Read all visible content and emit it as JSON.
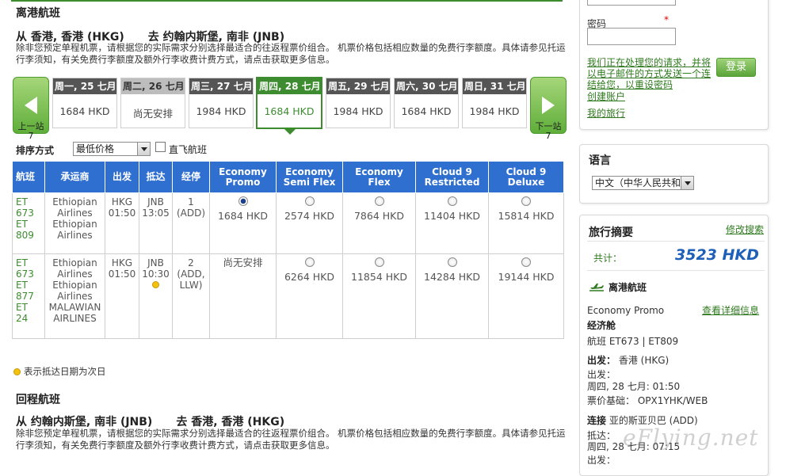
{
  "outbound": {
    "heading": "离港航班",
    "route_from": "从 香港, 香港 (HKG)",
    "route_to": "去 约翰内斯堡, 南非 (JNB)",
    "note": "除非您预定单程机票，请根据您的实际需求分别选择最适合的往返程票价组合。 机票价格包括相应数量的免费行李额度。具体请参见托运行李须知，有关免费行李额度及额外行李收费计费方式，请点击获取更多信息。"
  },
  "carousel": {
    "prev_label": "上一站 7",
    "next_label": "下一站 7",
    "days": [
      {
        "label": "周一, 25 七月",
        "price": "1684 HKD",
        "state": "normal"
      },
      {
        "label": "周二, 26 七月",
        "price": "尚无安排",
        "state": "na"
      },
      {
        "label": "周三, 27 七月",
        "price": "1984 HKD",
        "state": "normal"
      },
      {
        "label": "周四, 28 七月",
        "price": "1684 HKD",
        "state": "selected"
      },
      {
        "label": "周五, 29 七月",
        "price": "1984 HKD",
        "state": "normal"
      },
      {
        "label": "周六, 30 七月",
        "price": "1684 HKD",
        "state": "normal"
      },
      {
        "label": "周日, 31 七月",
        "price": "1984 HKD",
        "state": "normal"
      }
    ]
  },
  "sort": {
    "label": "排序方式",
    "selected": "最低价格",
    "direct_label": "直飞航班"
  },
  "table": {
    "headers": {
      "flight": "航班",
      "carrier": "承运商",
      "depart": "出发",
      "arrive": "抵达",
      "stops": "经停",
      "c1": "Economy Promo",
      "c2": "Economy Semi Flex",
      "c3": "Economy Flex",
      "c4": "Cloud 9 Restricted",
      "c5": "Cloud 9 Deluxe"
    },
    "rows": [
      {
        "flights": [
          "ET",
          "673",
          "ET",
          "809"
        ],
        "carriers": [
          "Ethiopian",
          "Airlines",
          "Ethiopian",
          "Airlines"
        ],
        "depart": [
          "HKG",
          "01:50"
        ],
        "arrive": [
          "JNB",
          "13:05"
        ],
        "stops": [
          "1",
          "(ADD)"
        ],
        "prices": [
          "1684 HKD",
          "2574 HKD",
          "7864 HKD",
          "11404 HKD",
          "15814 HKD"
        ]
      },
      {
        "flights": [
          "ET",
          "673",
          "ET",
          "877",
          "ET",
          "24"
        ],
        "carriers": [
          "Ethiopian",
          "Airlines",
          "Ethiopian",
          "Airlines",
          "MALAWIAN",
          "AIRLINES"
        ],
        "depart": [
          "HKG",
          "01:50"
        ],
        "arrive": [
          "JNB",
          "10:30"
        ],
        "stops": [
          "2",
          "(ADD,",
          "LLW)"
        ],
        "prices": [
          "尚无安排",
          "6264 HKD",
          "11854 HKD",
          "14284 HKD",
          "19144 HKD"
        ]
      }
    ]
  },
  "legend": "表示抵达日期为次日",
  "inbound": {
    "heading": "回程航班",
    "route_from": "从 约翰内斯堡, 南非 (JNB)",
    "route_to": "去 香港, 香港 (HKG)",
    "note": "除非您预定单程机票，请根据您的实际需求分别选择最适合的往返程票价组合。 机票价格包括相应数量的免费行李额度。具体请参见托运行李须知，有关免费行李额度及额外行李收费计费方式，请点击获取更多信息。"
  },
  "login": {
    "password_label": "密码",
    "required_mark": "*",
    "forgot_link": "我们正在处理您的请求，并将以电子邮件的方式发送一个连结给您，以重设密码",
    "login_button": "登录",
    "create_account": "创建账户",
    "my_trips": "我的旅行"
  },
  "language": {
    "title": "语言",
    "selected": "中文（中华人民共和"
  },
  "summary": {
    "title": "旅行摘要",
    "modify_link": "修改搜索",
    "total_label": "共计：",
    "total_value": "3523 HKD",
    "outbound_title": "离港航班",
    "fare_class": "Economy Promo",
    "details_link": "查看详细信息",
    "cabin": "经济舱",
    "flights": "航班 ET673 | ET809",
    "depart_label": "出发：",
    "depart_value": "香港 (HKG)",
    "depart_time_label": "出发：",
    "depart_time_value": "周四, 28 七月: 01:50",
    "fare_basis_label": "票价基础：",
    "fare_basis_value": "OPX1YHK/WEB",
    "connect_label": "连接",
    "connect_value": "亚的斯亚贝巴 (ADD)",
    "arrive_label": "抵达：",
    "arrive_value": "周四, 28 七月: 07:15",
    "truncated_label": "出发："
  },
  "watermark": "eFlying.net"
}
